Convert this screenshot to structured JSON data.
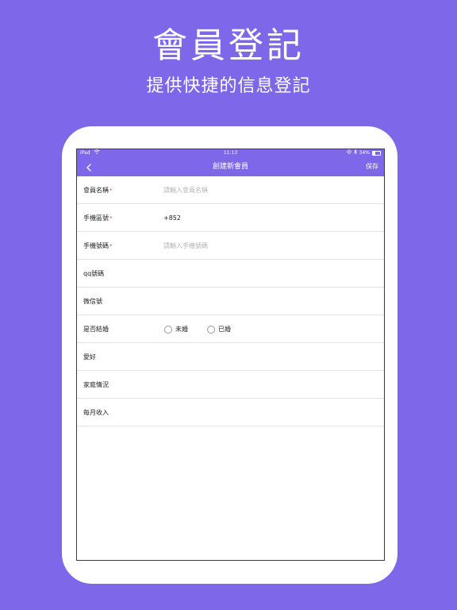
{
  "promo": {
    "title": "會員登記",
    "subtitle": "提供快捷的信息登記"
  },
  "status_bar": {
    "device": "iPad",
    "time": "11:13",
    "battery": "34%",
    "battery_level": 0.34
  },
  "nav": {
    "title": "創建新會員",
    "save_label": "保存"
  },
  "form": {
    "required_mark": "*",
    "member_name": {
      "label": "會員名稱",
      "placeholder": "請輸入會員名稱",
      "value": ""
    },
    "area_code": {
      "label": "手機區號",
      "value": "+852"
    },
    "phone": {
      "label": "手機號碼",
      "placeholder": "請輸入手機號碼",
      "value": ""
    },
    "qq": {
      "label": "qq號碼",
      "value": ""
    },
    "wechat": {
      "label": "微信號",
      "value": ""
    },
    "married": {
      "label": "是否結婚",
      "options": [
        "未婚",
        "已婚"
      ]
    },
    "hobby": {
      "label": "愛好",
      "value": ""
    },
    "family": {
      "label": "家庭情況",
      "value": ""
    },
    "income": {
      "label": "每月收入",
      "value": ""
    }
  },
  "colors": {
    "accent": "#7f67ea",
    "required": "#e8423f",
    "placeholder": "#b4b4b4"
  }
}
